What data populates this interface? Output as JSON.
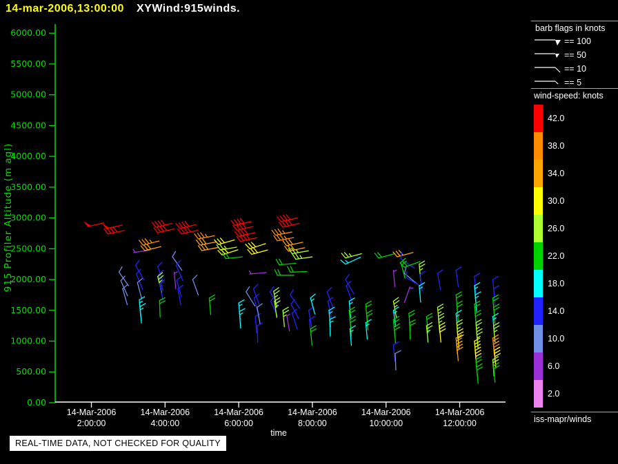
{
  "header": {
    "datetime": "14-mar-2006,13:00:00",
    "plot_name": "XYWind:915winds."
  },
  "colors": {
    "background": "#000000",
    "y_axis_green": "#00e000",
    "x_axis_white": "#ffffff",
    "separator_gray": "#a8a8a8",
    "title_yellow": "#ffff00"
  },
  "y_axis": {
    "label": "915 Profiler Altitude (m agl)",
    "ticks": [
      "6000.00",
      "5500.00",
      "5000.00",
      "4500.00",
      "4000.00",
      "3500.00",
      "3000.00",
      "2500.00",
      "2000.00",
      "1500.00",
      "1000.00",
      "500.00",
      "0.00"
    ]
  },
  "x_axis": {
    "label": "time",
    "ticks": [
      {
        "date": "14-Mar-2006",
        "time": "2:00:00"
      },
      {
        "date": "14-Mar-2006",
        "time": "4:00:00"
      },
      {
        "date": "14-Mar-2006",
        "time": "6:00:00"
      },
      {
        "date": "14-Mar-2006",
        "time": "8:00:00"
      },
      {
        "date": "14-Mar-2006",
        "time": "10:00:00"
      },
      {
        "date": "14-Mar-2006",
        "time": "12:00:00"
      }
    ]
  },
  "legend": {
    "barb_flags_title": "barb flags in knots",
    "barb_rows": [
      {
        "glyph": "flag-100",
        "label": "== 100"
      },
      {
        "glyph": "flag-50",
        "label": "== 50"
      },
      {
        "glyph": "barb-10",
        "label": "== 10"
      },
      {
        "glyph": "barb-5",
        "label": "== 5"
      }
    ],
    "speed_title": "wind-speed: knots",
    "colorbar": [
      {
        "value": "42.0",
        "color": "#ff0000"
      },
      {
        "value": "38.0",
        "color": "#ff8c00"
      },
      {
        "value": "34.0",
        "color": "#ffa500"
      },
      {
        "value": "30.0",
        "color": "#ffff00"
      },
      {
        "value": "26.0",
        "color": "#adff2f"
      },
      {
        "value": "22.0",
        "color": "#00d400"
      },
      {
        "value": "18.0",
        "color": "#00ffff"
      },
      {
        "value": "14.0",
        "color": "#2222ff"
      },
      {
        "value": "10.0",
        "color": "#7090e8"
      },
      {
        "value": "6.0",
        "color": "#9b30d9"
      },
      {
        "value": "2.0",
        "color": "#ee82ee"
      }
    ]
  },
  "footer": {
    "credit": "iss-mapr/winds",
    "warning": "REAL-TIME DATA, NOT CHECKED FOR QUALITY"
  },
  "chart_data": {
    "type": "wind-barb-time-height",
    "title": "XYWind:915winds.",
    "valid_at": "14-mar-2006,13:00:00",
    "xlabel": "time",
    "ylabel": "915 Profiler Altitude (m agl)",
    "x_hours_range": [
      1.0,
      13.23
    ],
    "x_tick_hours": [
      2,
      4,
      6,
      8,
      10,
      12
    ],
    "alt_range_m": [
      0,
      6000
    ],
    "alt_tick_step_m": 500,
    "grid": false,
    "legend_position": "right",
    "speed_color_bins_knots": [
      2,
      6,
      10,
      14,
      18,
      22,
      26,
      30,
      34,
      38,
      42
    ],
    "barb_format": "[hour_of_day, altitude_m_agl, speed_knots, staff_screen_angle_deg]",
    "barbs": [
      [
        1.9,
        2860,
        50,
        13
      ],
      [
        2.4,
        2825,
        50,
        13
      ],
      [
        2.45,
        2740,
        42,
        12
      ],
      [
        2.75,
        2120,
        10,
        -55
      ],
      [
        2.8,
        1980,
        10,
        -66
      ],
      [
        2.85,
        1850,
        10,
        -74
      ],
      [
        3.15,
        2440,
        6,
        8
      ],
      [
        3.2,
        2230,
        14,
        -60
      ],
      [
        3.22,
        2090,
        14,
        -68
      ],
      [
        3.25,
        1950,
        10,
        -75
      ],
      [
        3.3,
        1670,
        18,
        -85
      ],
      [
        3.32,
        1560,
        18,
        -85
      ],
      [
        3.4,
        2560,
        36,
        14
      ],
      [
        3.45,
        2470,
        34,
        14
      ],
      [
        3.75,
        2850,
        42,
        13
      ],
      [
        3.8,
        2760,
        40,
        13
      ],
      [
        3.8,
        2210,
        14,
        -70
      ],
      [
        3.82,
        2080,
        14,
        -74
      ],
      [
        3.8,
        2050,
        26,
        -76
      ],
      [
        3.85,
        1930,
        14,
        -78
      ],
      [
        3.85,
        1660,
        22,
        -88
      ],
      [
        4.2,
        2370,
        10,
        -55
      ],
      [
        4.25,
        2120,
        6,
        -85
      ],
      [
        4.3,
        2230,
        14,
        -66
      ],
      [
        4.32,
        1990,
        14,
        -75
      ],
      [
        4.35,
        1850,
        14,
        -80
      ],
      [
        4.4,
        2830,
        42,
        13
      ],
      [
        4.45,
        2740,
        40,
        13
      ],
      [
        4.75,
        2000,
        10,
        -70
      ],
      [
        4.9,
        2660,
        36,
        11
      ],
      [
        4.95,
        2560,
        34,
        11
      ],
      [
        5.0,
        2470,
        34,
        11
      ],
      [
        5.2,
        1700,
        22,
        -85
      ],
      [
        5.45,
        2570,
        30,
        16
      ],
      [
        5.5,
        2480,
        26,
        10
      ],
      [
        5.55,
        2400,
        30,
        18
      ],
      [
        5.65,
        2340,
        22,
        6
      ],
      [
        5.9,
        2880,
        42,
        13
      ],
      [
        5.95,
        2800,
        40,
        13
      ],
      [
        6.0,
        2700,
        40,
        13
      ],
      [
        6.05,
        2620,
        42,
        13
      ],
      [
        6.0,
        1620,
        18,
        -85
      ],
      [
        6.02,
        1480,
        18,
        -86
      ],
      [
        6.2,
        1800,
        10,
        -58
      ],
      [
        6.3,
        2500,
        30,
        18
      ],
      [
        6.35,
        2410,
        30,
        15
      ],
      [
        6.3,
        2090,
        6,
        5
      ],
      [
        6.4,
        1850,
        14,
        -70
      ],
      [
        6.42,
        1700,
        14,
        -76
      ],
      [
        6.45,
        1400,
        14,
        -85
      ],
      [
        6.5,
        1250,
        14,
        -88
      ],
      [
        6.5,
        1550,
        10,
        -80
      ],
      [
        6.85,
        1800,
        14,
        -60
      ],
      [
        6.87,
        1650,
        14,
        -66
      ],
      [
        6.95,
        1810,
        26,
        -80
      ],
      [
        6.97,
        1650,
        26,
        -82
      ],
      [
        7.0,
        2720,
        38,
        11
      ],
      [
        7.05,
        2630,
        36,
        11
      ],
      [
        7.05,
        2070,
        22,
        0
      ],
      [
        7.1,
        2240,
        22,
        5
      ],
      [
        7.15,
        2940,
        42,
        13
      ],
      [
        7.2,
        2850,
        40,
        13
      ],
      [
        7.2,
        1500,
        26,
        -85
      ],
      [
        7.3,
        1430,
        6,
        -80
      ],
      [
        7.3,
        2550,
        34,
        12
      ],
      [
        7.35,
        2460,
        34,
        12
      ],
      [
        7.4,
        2120,
        22,
        2
      ],
      [
        7.4,
        1750,
        14,
        -55
      ],
      [
        7.42,
        1600,
        14,
        -62
      ],
      [
        7.45,
        1450,
        14,
        -72
      ],
      [
        7.45,
        2420,
        26,
        10
      ],
      [
        7.55,
        2330,
        26,
        8
      ],
      [
        7.9,
        1500,
        14,
        -80
      ],
      [
        7.92,
        1350,
        14,
        -85
      ],
      [
        7.95,
        1700,
        18,
        -75
      ],
      [
        7.95,
        1200,
        22,
        -85
      ],
      [
        8.4,
        1800,
        14,
        -70
      ],
      [
        8.42,
        1650,
        14,
        -78
      ],
      [
        8.45,
        1500,
        18,
        -85
      ],
      [
        8.47,
        1350,
        18,
        -88
      ],
      [
        8.9,
        2350,
        26,
        15
      ],
      [
        8.9,
        2250,
        18,
        25
      ],
      [
        8.9,
        2000,
        14,
        -60
      ],
      [
        8.92,
        1900,
        14,
        -70
      ],
      [
        9.0,
        1650,
        18,
        -85
      ],
      [
        9.0,
        1500,
        22,
        -85
      ],
      [
        9.02,
        1350,
        22,
        -85
      ],
      [
        9.02,
        1200,
        18,
        -85
      ],
      [
        9.45,
        1600,
        22,
        -85
      ],
      [
        9.47,
        1450,
        22,
        -85
      ],
      [
        9.45,
        1300,
        18,
        -85
      ],
      [
        9.8,
        2350,
        22,
        15
      ],
      [
        10.2,
        2150,
        6,
        -85
      ],
      [
        10.2,
        1650,
        26,
        -80
      ],
      [
        10.2,
        1500,
        18,
        -82
      ],
      [
        10.2,
        1350,
        22,
        -85
      ],
      [
        10.22,
        1230,
        22,
        -85
      ],
      [
        10.2,
        940,
        14,
        -85
      ],
      [
        10.25,
        800,
        10,
        -88
      ],
      [
        10.3,
        2370,
        34,
        15
      ],
      [
        10.4,
        2340,
        14,
        -35
      ],
      [
        10.4,
        2280,
        22,
        -75
      ],
      [
        10.5,
        2200,
        22,
        20
      ],
      [
        10.5,
        2100,
        10,
        -40
      ],
      [
        10.55,
        2030,
        14,
        -30
      ],
      [
        10.62,
        1450,
        22,
        -85
      ],
      [
        10.64,
        1300,
        22,
        -88
      ],
      [
        10.65,
        1880,
        6,
        -110
      ],
      [
        10.9,
        2250,
        26,
        -85
      ],
      [
        10.92,
        2080,
        14,
        -82
      ],
      [
        10.9,
        1900,
        18,
        -85
      ],
      [
        11.1,
        1400,
        22,
        -85
      ],
      [
        11.1,
        1250,
        26,
        -85
      ],
      [
        11.4,
        2100,
        14,
        -80
      ],
      [
        11.4,
        1550,
        26,
        -85
      ],
      [
        11.42,
        1400,
        26,
        -85
      ],
      [
        11.45,
        1250,
        30,
        -85
      ],
      [
        11.9,
        2150,
        14,
        -82
      ],
      [
        11.9,
        1750,
        22,
        -85
      ],
      [
        11.92,
        1600,
        22,
        -85
      ],
      [
        11.9,
        1450,
        18,
        -85
      ],
      [
        11.92,
        1300,
        26,
        -86
      ],
      [
        11.94,
        1150,
        30,
        -85
      ],
      [
        11.9,
        1050,
        34,
        -85
      ],
      [
        11.92,
        950,
        34,
        -85
      ],
      [
        12.4,
        2050,
        14,
        -85
      ],
      [
        12.4,
        1900,
        18,
        -85
      ],
      [
        12.42,
        1750,
        18,
        -85
      ],
      [
        12.4,
        1600,
        22,
        -85
      ],
      [
        12.42,
        1450,
        22,
        -85
      ],
      [
        12.44,
        1300,
        26,
        -85
      ],
      [
        12.46,
        1150,
        26,
        -85
      ],
      [
        12.4,
        1000,
        30,
        -85
      ],
      [
        12.42,
        850,
        30,
        -85
      ],
      [
        12.44,
        700,
        22,
        -85
      ],
      [
        12.46,
        580,
        22,
        -85
      ],
      [
        12.9,
        2000,
        14,
        -85
      ],
      [
        12.92,
        1850,
        14,
        -85
      ],
      [
        12.9,
        1700,
        22,
        -85
      ],
      [
        12.92,
        1550,
        22,
        -85
      ],
      [
        12.9,
        1400,
        18,
        -85
      ],
      [
        12.92,
        1250,
        26,
        -85
      ],
      [
        12.9,
        1050,
        34,
        -85
      ],
      [
        12.92,
        950,
        36,
        -85
      ],
      [
        12.94,
        850,
        30,
        -85
      ],
      [
        12.9,
        700,
        26,
        -86
      ],
      [
        12.92,
        600,
        22,
        -85
      ]
    ]
  }
}
